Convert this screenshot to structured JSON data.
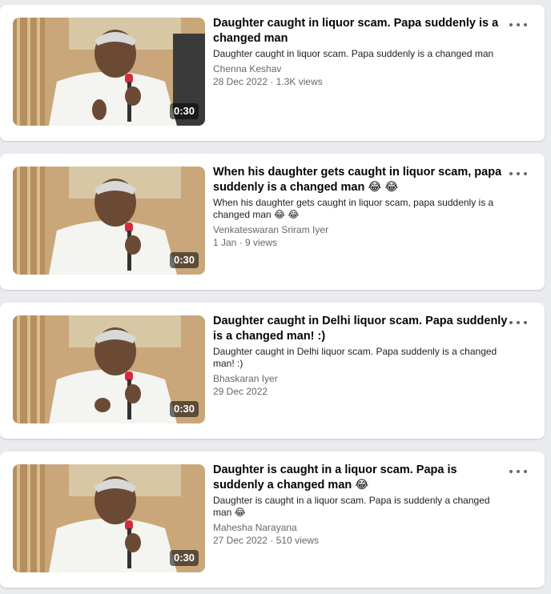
{
  "videos": [
    {
      "title": "Daughter caught in liquor scam. Papa suddenly is a changed man",
      "description": "Daughter caught in liquor scam. Papa suddenly is a changed man",
      "author": "Chenna Keshav",
      "meta": "28 Dec 2022 · 1.3K views",
      "duration": "0:30"
    },
    {
      "title": "When his daughter gets caught in liquor scam, papa suddenly is a changed man 😂 😂",
      "description": "When his daughter gets caught in liquor scam, papa suddenly is a changed man 😂 😂",
      "author": "Venkateswaran Sriram Iyer",
      "meta": "1 Jan · 9 views",
      "duration": "0:30"
    },
    {
      "title": "Daughter caught in Delhi liquor scam. Papa suddenly is a changed man! :)",
      "description": "Daughter caught in Delhi liquor scam. Papa suddenly is a changed man! :)",
      "author": "Bhaskaran Iyer",
      "meta": "29 Dec 2022",
      "duration": "0:30"
    },
    {
      "title": "Daughter is caught in a liquor scam. Papa is suddenly a changed man 😂",
      "description": "Daughter is caught in a liquor scam. Papa is suddenly a changed man 😂",
      "author": "Mahesha Narayana",
      "meta": "27 Dec 2022 · 510 views",
      "duration": "0:30"
    }
  ],
  "icons": {
    "more": "more-options-icon"
  }
}
